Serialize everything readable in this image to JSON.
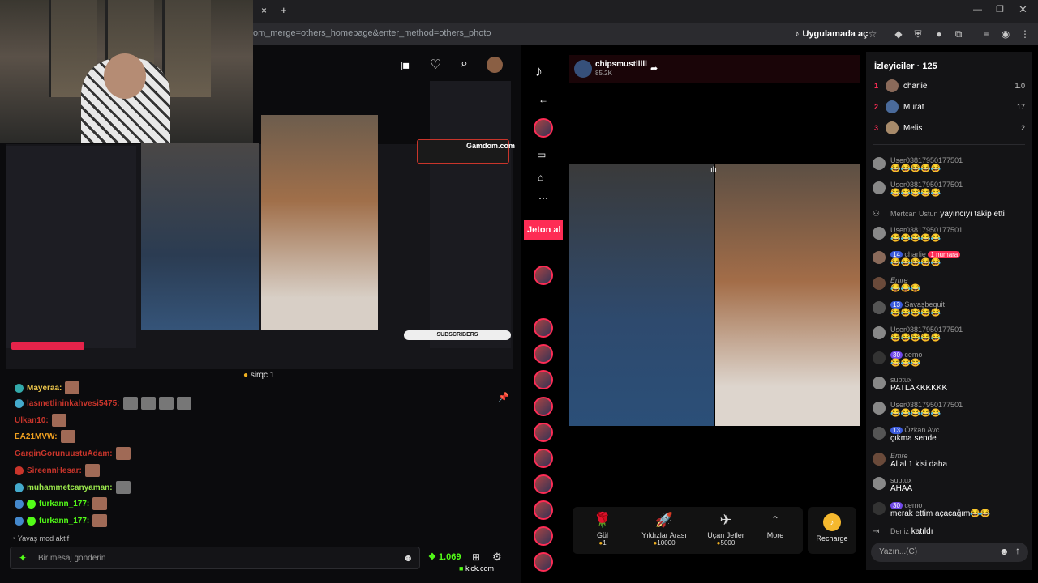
{
  "browser": {
    "url": "om_merge=others_homepage&enter_method=others_photo",
    "open_in_app": "Uygulamada aç",
    "new_tab": "+",
    "close_tab": "×"
  },
  "left_stream": {
    "overlay_text": "Gamdom.com",
    "overlay_sub": "SUBSCRIBERS",
    "gift_notice": "sirqc",
    "gift_count": "1",
    "chat": [
      {
        "user": "Mayeraa:",
        "color": "#e8c24a"
      },
      {
        "user": "lasmetlininkahvesi5475:",
        "color": "#c9352b"
      },
      {
        "user": "Ulkan10:",
        "color": "#c9352b"
      },
      {
        "user": "EA21MVW:",
        "color": "#f0a020"
      },
      {
        "user": "GarginGorunuustuAdam:",
        "color": "#c9352b"
      },
      {
        "user": "SireennHesar:",
        "color": "#c9352b"
      },
      {
        "user": "muhammetcanyaman:",
        "color": "#9be84c"
      },
      {
        "user": "furkann_177:",
        "color": "#53fc18"
      },
      {
        "user": "furkann_177:",
        "color": "#53fc18"
      }
    ],
    "slow_mode": "Yavaş mod aktif",
    "message_placeholder": "Bir mesaj gönderin",
    "balance": "1.069",
    "kick_tab": "kick.com"
  },
  "tiktok": {
    "host_name": "chipsmustlllll",
    "host_likes": "85.2K",
    "jeton": "Jeton al",
    "gifts": [
      {
        "name": "Gül",
        "price": "1",
        "icon": "🌹"
      },
      {
        "name": "Yıldızlar Arası",
        "price": "10000",
        "icon": "🚀"
      },
      {
        "name": "Uçan Jetler",
        "price": "5000",
        "icon": "✈"
      }
    ],
    "more": "More",
    "recharge": "Recharge",
    "viewers_title": "İzleyiciler",
    "viewers_count": "125",
    "viewers": [
      {
        "rank": "1",
        "name": "charlie",
        "score": "1.0"
      },
      {
        "rank": "2",
        "name": "Murat",
        "score": "17"
      },
      {
        "rank": "3",
        "name": "Melis",
        "score": "2"
      }
    ],
    "chat": [
      {
        "name": "User03817950177501",
        "text": "😂😂😂😂😂",
        "level": "",
        "top": "193"
      },
      {
        "name": "User03817950177501",
        "text": "😂😂😂😂😂",
        "level": "",
        "top": "223"
      },
      {
        "name": "Mertcan Ustun",
        "text": "yayıncıyı takip etti",
        "level": "",
        "top": "258"
      },
      {
        "name": "User03817950177501",
        "text": "😂😂😂😂😂",
        "level": "",
        "top": "279"
      },
      {
        "name": "charlie",
        "text": "😂😂😂😂😂",
        "level": "14",
        "top": "309",
        "tag": "1 numara"
      },
      {
        "name": "Emre",
        "text": "😂😂😂",
        "level": "",
        "top": "341"
      },
      {
        "name": "Savaşbequit",
        "text": "😂😂😂😂😂",
        "level": "13",
        "top": "371"
      },
      {
        "name": "User03817950177501",
        "text": "😂😂😂😂😂",
        "level": "",
        "top": "402"
      },
      {
        "name": "cemo",
        "text": "😂😂😂",
        "level": "30",
        "top": "433"
      },
      {
        "name": "suptux",
        "text": "PATLAKKKKKK",
        "level": "",
        "top": "464"
      },
      {
        "name": "User03817950177501",
        "text": "😂😂😂😂😂",
        "level": "",
        "top": "495"
      },
      {
        "name": "Özkan Avc",
        "text": "çıkma sende",
        "level": "13",
        "top": "526"
      },
      {
        "name": "Emre",
        "text": "Al al 1 kisi daha",
        "level": "",
        "top": "558"
      },
      {
        "name": "suptux",
        "text": "AHAA",
        "level": "",
        "top": "588"
      },
      {
        "name": "cemo",
        "text": "merak ettim açacağım😂😂",
        "level": "30",
        "top": "619"
      },
      {
        "name": "Deniz",
        "text": "katıldı",
        "level": "",
        "top": "650"
      }
    ],
    "input_placeholder": "Yazın...(C)"
  }
}
